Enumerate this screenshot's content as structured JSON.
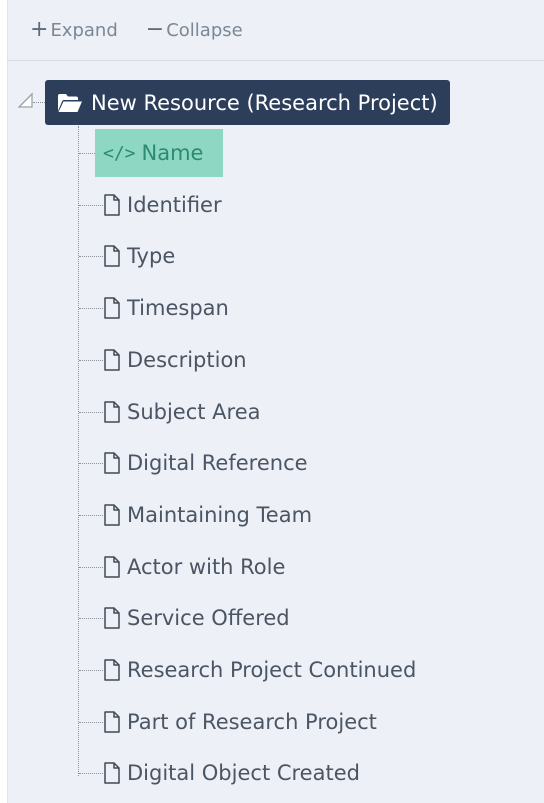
{
  "toolbar": {
    "expand_label": "Expand",
    "collapse_label": "Collapse",
    "expand_icon": "plus-icon",
    "collapse_icon": "minus-icon"
  },
  "tree": {
    "root": {
      "label": "New Resource (Research Project)",
      "icon": "folder-open-icon",
      "expanded": true
    },
    "children": [
      {
        "label": "Name",
        "icon": "code-icon",
        "selected": true
      },
      {
        "label": "Identifier",
        "icon": "file-icon",
        "selected": false
      },
      {
        "label": "Type",
        "icon": "file-icon",
        "selected": false
      },
      {
        "label": "Timespan",
        "icon": "file-icon",
        "selected": false
      },
      {
        "label": "Description",
        "icon": "file-icon",
        "selected": false
      },
      {
        "label": "Subject Area",
        "icon": "file-icon",
        "selected": false
      },
      {
        "label": "Digital Reference",
        "icon": "file-icon",
        "selected": false
      },
      {
        "label": "Maintaining Team",
        "icon": "file-icon",
        "selected": false
      },
      {
        "label": "Actor with Role",
        "icon": "file-icon",
        "selected": false
      },
      {
        "label": "Service Offered",
        "icon": "file-icon",
        "selected": false
      },
      {
        "label": "Research Project Continued",
        "icon": "file-icon",
        "selected": false
      },
      {
        "label": "Part of Research Project",
        "icon": "file-icon",
        "selected": false
      },
      {
        "label": "Digital Object Created",
        "icon": "file-icon",
        "selected": false
      }
    ]
  },
  "colors": {
    "background": "#edf0f6",
    "root_node_bg": "#2c3e5a",
    "selected_bg": "#8ed7c2",
    "selected_text": "#2d8a72",
    "text": "#4b5563"
  }
}
